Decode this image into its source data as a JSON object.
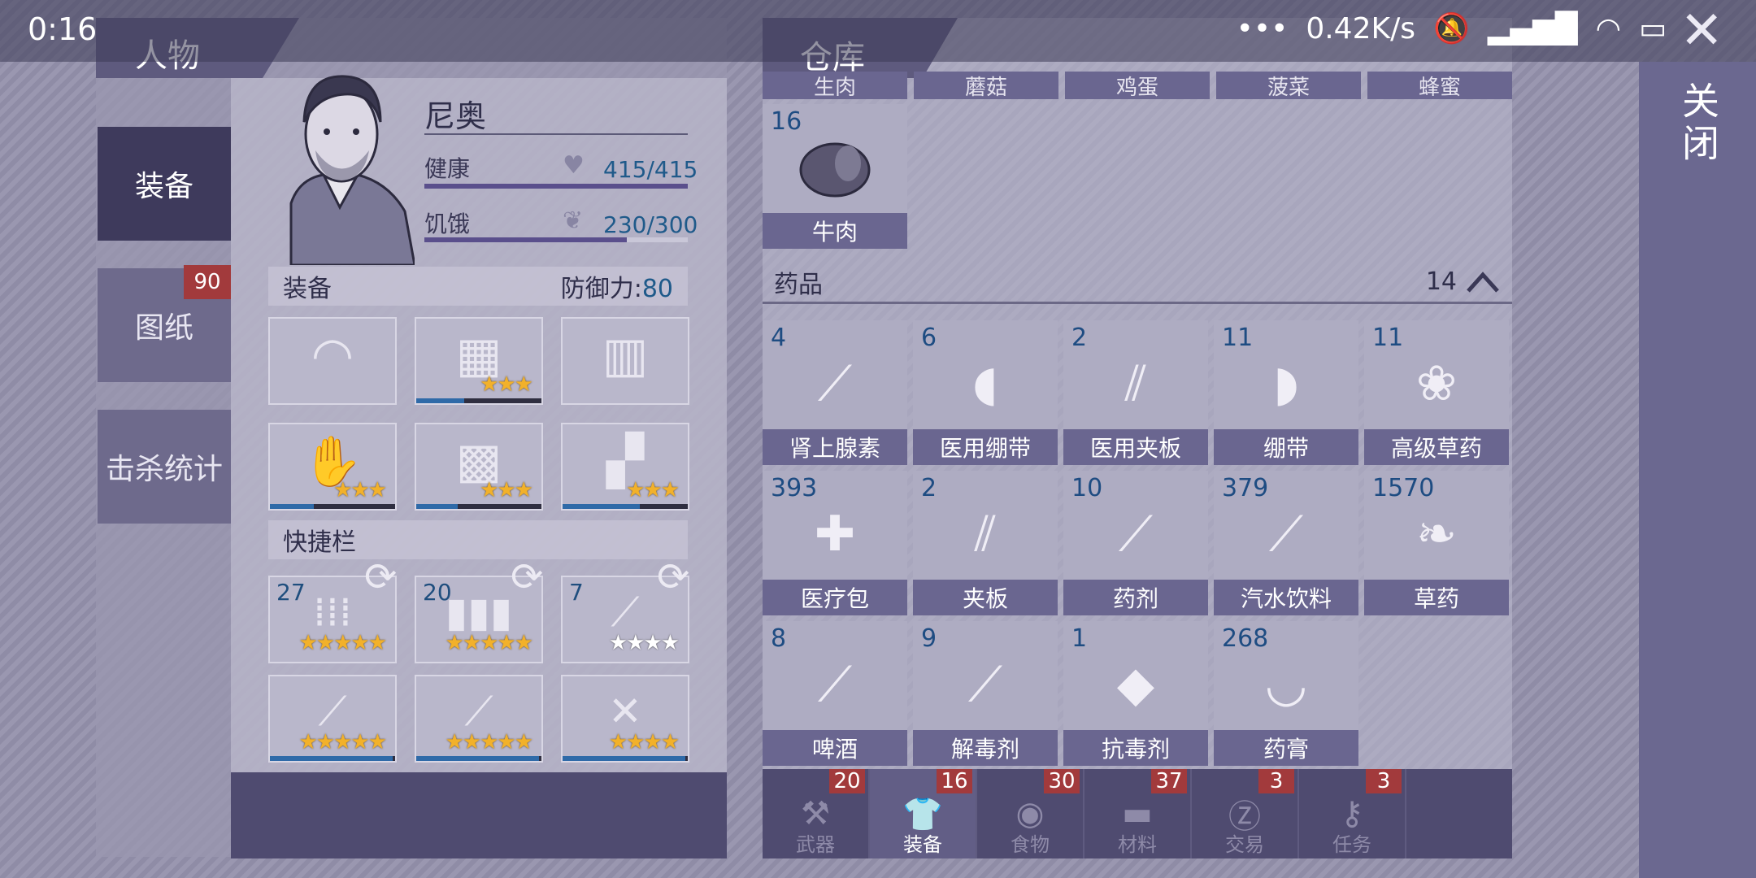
{
  "status": {
    "time": "0:16",
    "dots": "•••",
    "speed": "0.42K/s"
  },
  "left_panel": {
    "title": "人物",
    "tabs": [
      {
        "label": "装备",
        "active": true
      },
      {
        "label": "图纸",
        "badge": "90"
      },
      {
        "label": "击杀统计"
      }
    ],
    "character": {
      "name": "尼奥",
      "health_label": "健康",
      "health_value": "415/415",
      "health_fraction": 1.0,
      "hunger_label": "饥饿",
      "hunger_value": "230/300",
      "hunger_fraction": 0.767
    },
    "equip_section": {
      "label": "装备",
      "defense_label": "防御力:",
      "defense_value": "80"
    },
    "equipment_slots": [
      {
        "icon": "hat-icon",
        "stars": 0,
        "durability": null
      },
      {
        "icon": "armor-vest-icon",
        "stars": 3,
        "durability": 0.38
      },
      {
        "icon": "jacket-icon",
        "stars": 0,
        "durability": null
      },
      {
        "icon": "gloves-icon",
        "stars": 3,
        "durability": 0.35
      },
      {
        "icon": "armored-shorts-icon",
        "stars": 3,
        "durability": 0.33
      },
      {
        "icon": "boots-icon",
        "stars": 3,
        "durability": 0.62
      }
    ],
    "quickbar": {
      "label": "快捷栏"
    },
    "quick_slots": [
      {
        "count": "27",
        "icon": "rifle-ammo-icon",
        "stars": 5
      },
      {
        "count": "20",
        "icon": "shotgun-shells-icon",
        "stars": 5
      },
      {
        "count": "7",
        "icon": "poison-spear-icon",
        "stars": 0,
        "stars_total": 4
      },
      {
        "icon": "shotgun-icon",
        "stars": 5,
        "durability": 0.98
      },
      {
        "icon": "pump-shotgun-icon",
        "stars": 5,
        "durability": 0.98
      },
      {
        "icon": "crossbow-icon",
        "stars": 4,
        "durability": 0.98
      }
    ]
  },
  "right_panel": {
    "title": "仓库",
    "top_row_labels": [
      "生肉",
      "蘑菇",
      "鸡蛋",
      "菠菜",
      "蜂蜜"
    ],
    "food_item": {
      "count": "16",
      "name": "牛肉",
      "icon": "beef-icon"
    },
    "category": {
      "label": "药品",
      "count": "14"
    },
    "medicine": [
      {
        "count": "4",
        "name": "肾上腺素",
        "icon": "syringe-icon"
      },
      {
        "count": "6",
        "name": "医用绷带",
        "icon": "medical-bandage-icon"
      },
      {
        "count": "2",
        "name": "医用夹板",
        "icon": "medical-splint-icon"
      },
      {
        "count": "11",
        "name": "绷带",
        "icon": "bandage-icon"
      },
      {
        "count": "11",
        "name": "高级草药",
        "icon": "premium-herb-icon"
      },
      {
        "count": "393",
        "name": "医疗包",
        "icon": "medkit-icon"
      },
      {
        "count": "2",
        "name": "夹板",
        "icon": "splint-icon"
      },
      {
        "count": "10",
        "name": "药剂",
        "icon": "potion-icon"
      },
      {
        "count": "379",
        "name": "汽水饮料",
        "icon": "soda-icon"
      },
      {
        "count": "1570",
        "name": "草药",
        "icon": "herb-icon"
      },
      {
        "count": "8",
        "name": "啤酒",
        "icon": "beer-icon"
      },
      {
        "count": "9",
        "name": "解毒剂",
        "icon": "antidote-icon"
      },
      {
        "count": "1",
        "name": "抗毒剂",
        "icon": "antitoxin-icon"
      },
      {
        "count": "268",
        "name": "药膏",
        "icon": "ointment-icon"
      }
    ],
    "bottom_tabs": [
      {
        "label": "武器",
        "badge": "20",
        "icon": "axe-icon"
      },
      {
        "label": "装备",
        "badge": "16",
        "icon": "shirt-icon",
        "selected": true
      },
      {
        "label": "食物",
        "badge": "30",
        "icon": "meat-icon"
      },
      {
        "label": "材料",
        "badge": "37",
        "icon": "log-icon"
      },
      {
        "label": "交易",
        "badge": "3",
        "icon": "coin-icon"
      },
      {
        "label": "任务",
        "badge": "3",
        "icon": "key-icon"
      }
    ]
  },
  "close_label": "关闭",
  "colors": {
    "accent_blue": "#1f5a8a",
    "badge_red": "#a23a3c",
    "star_gold": "#f2b12a",
    "tab_dark": "#4f4b70"
  }
}
